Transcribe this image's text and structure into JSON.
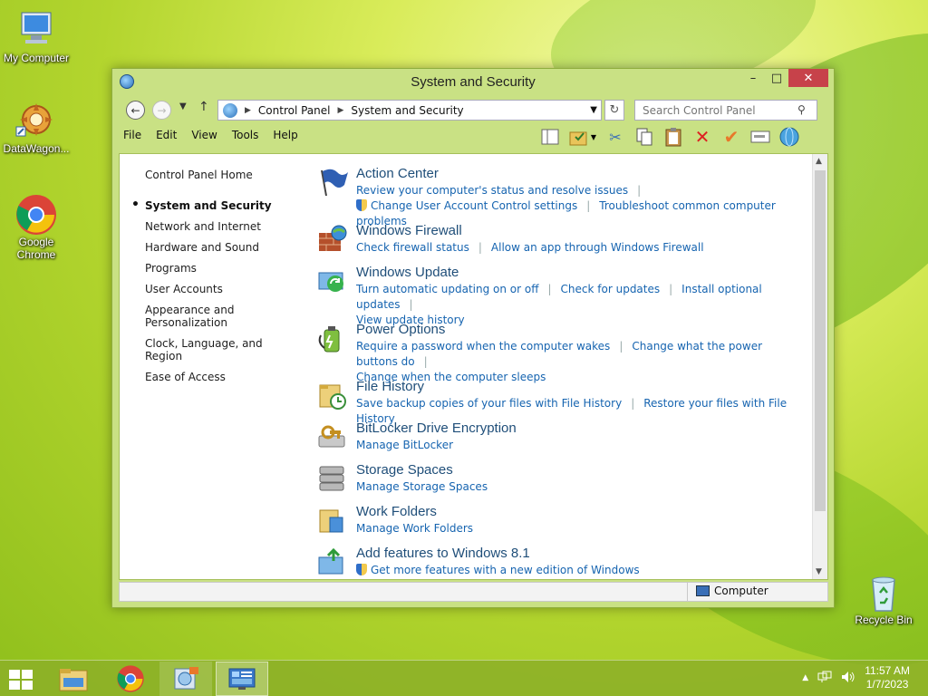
{
  "desktop": {
    "icons": [
      {
        "label": "My Computer"
      },
      {
        "label": "DataWagon..."
      },
      {
        "label": "Google Chrome"
      },
      {
        "label": "Recycle Bin"
      }
    ]
  },
  "window": {
    "title": "System and Security",
    "controls": {
      "minimize": "–",
      "maximize": "□",
      "close": "✕"
    },
    "address": {
      "crumbs": [
        "Control Panel",
        "System and Security"
      ],
      "search_placeholder": "Search Control Panel"
    },
    "menu": [
      "File",
      "Edit",
      "View",
      "Tools",
      "Help"
    ],
    "nav": {
      "home": "Control Panel Home",
      "items": [
        {
          "label": "System and Security",
          "active": true
        },
        {
          "label": "Network and Internet"
        },
        {
          "label": "Hardware and Sound"
        },
        {
          "label": "Programs"
        },
        {
          "label": "User Accounts"
        },
        {
          "label": "Appearance and Personalization"
        },
        {
          "label": "Clock, Language, and Region"
        },
        {
          "label": "Ease of Access"
        }
      ]
    },
    "categories": [
      {
        "title": "Action Center",
        "icon": "flag-icon",
        "lines": [
          [
            "Review your computer's status and resolve issues"
          ],
          [
            "Change User Account Control settings",
            "Troubleshoot common computer problems"
          ]
        ]
      },
      {
        "title": "Windows Firewall",
        "icon": "firewall-icon",
        "lines": [
          [
            "Check firewall status",
            "Allow an app through Windows Firewall"
          ]
        ]
      },
      {
        "title": "Windows Update",
        "icon": "update-icon",
        "lines": [
          [
            "Turn automatic updating on or off",
            "Check for updates",
            "Install optional updates"
          ],
          [
            "View update history"
          ]
        ]
      },
      {
        "title": "Power Options",
        "icon": "power-icon",
        "lines": [
          [
            "Require a password when the computer wakes",
            "Change what the power buttons do"
          ],
          [
            "Change when the computer sleeps"
          ]
        ]
      },
      {
        "title": "File History",
        "icon": "file-history-icon",
        "lines": [
          [
            "Save backup copies of your files with File History",
            "Restore your files with File History"
          ]
        ]
      },
      {
        "title": "BitLocker Drive Encryption",
        "icon": "bitlocker-icon",
        "lines": [
          [
            "Manage BitLocker"
          ]
        ]
      },
      {
        "title": "Storage Spaces",
        "icon": "storage-icon",
        "lines": [
          [
            "Manage Storage Spaces"
          ]
        ]
      },
      {
        "title": "Work Folders",
        "icon": "work-folders-icon",
        "lines": [
          [
            "Manage Work Folders"
          ]
        ]
      },
      {
        "title": "Add features to Windows 8.1",
        "icon": "add-features-icon",
        "lines": [
          [
            "Get more features with a new edition of Windows"
          ]
        ]
      }
    ],
    "status": {
      "location": "Computer"
    }
  },
  "taskbar": {
    "clock": {
      "time": "11:57 AM",
      "date": "1/7/2023"
    }
  },
  "colors": {
    "link": "#1664b0",
    "category_title": "#1f4e79",
    "close_button": "#c7424a"
  }
}
